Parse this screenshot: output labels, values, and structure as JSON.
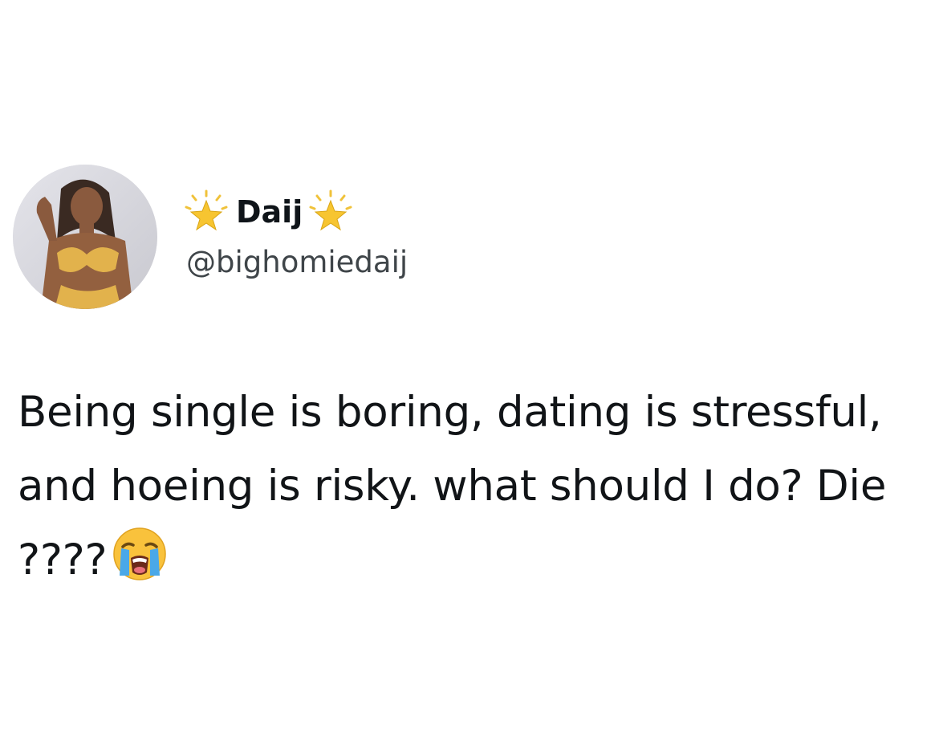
{
  "tweet": {
    "display_name": "Daij",
    "handle": "@bighomiedaij",
    "text": "Being single is boring, dating is stressful, and hoeing is risky. what should I do? Die ????",
    "emoji": "loudly-crying-face-icon",
    "name_decoration_icon": "glowing-star-icon"
  },
  "colors": {
    "background": "#ffffff",
    "text": "#0f1419",
    "handle": "#3f4549",
    "star": "#f7c531",
    "emoji_face": "#f9c23c",
    "emoji_tears": "#4aa8e8"
  }
}
